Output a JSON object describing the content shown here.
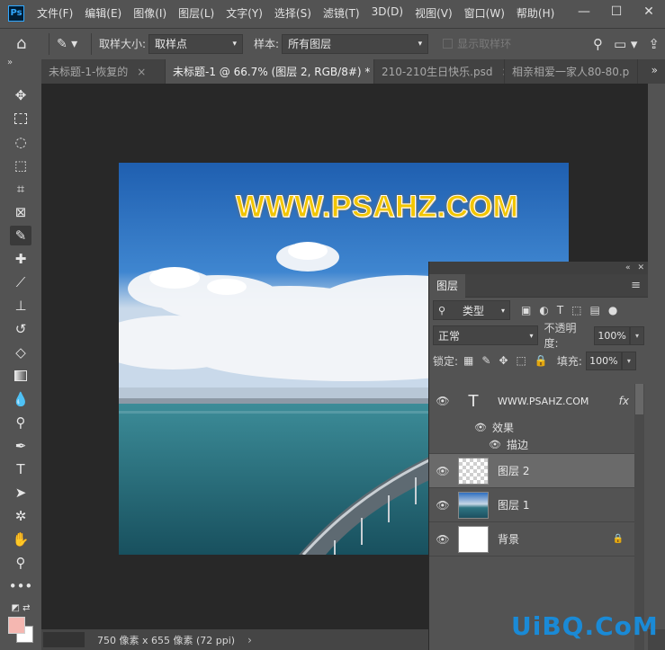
{
  "app": {
    "logo": "Ps"
  },
  "menu": [
    "文件(F)",
    "编辑(E)",
    "图像(I)",
    "图层(L)",
    "文字(Y)",
    "选择(S)",
    "滤镜(T)",
    "3D(D)",
    "视图(V)",
    "窗口(W)",
    "帮助(H)"
  ],
  "window_controls": {
    "minimize": "—",
    "maximize": "☐",
    "close": "✕"
  },
  "options": {
    "sample_size_label": "取样大小:",
    "sample_size_value": "取样点",
    "sample_label": "样本:",
    "sample_value": "所有图层",
    "show_ring_label": "显示取样环"
  },
  "tabs": [
    {
      "label": "未标题-1-恢复的",
      "close": "×"
    },
    {
      "label": "未标题-1 @ 66.7% (图层 2, RGB/8#) *",
      "close": "×"
    },
    {
      "label": "210-210生日快乐.psd",
      "close": "×"
    },
    {
      "label": "相亲相爱一家人80-80.p",
      "close": ""
    }
  ],
  "tabs_overflow": "»",
  "toolbar_collapse": "»",
  "canvas": {
    "headline": "WWW.PSAHZ.COM"
  },
  "status": {
    "info": "750 像素 x 655 像素 (72 ppi)",
    "arrow": "›"
  },
  "layers_panel": {
    "title": "图层",
    "filter_type": "类型",
    "blend_mode": "正常",
    "opacity_label": "不透明度:",
    "opacity_value": "100%",
    "lock_label": "锁定:",
    "fill_label": "填充:",
    "fill_value": "100%",
    "layers": [
      {
        "name": "WWW.PSAHZ.COM",
        "kind": "text",
        "fx": "fx"
      },
      {
        "name": "图层 2",
        "kind": "transparent",
        "selected": true
      },
      {
        "name": "图层 1",
        "kind": "image"
      },
      {
        "name": "背景",
        "kind": "white",
        "locked": true
      }
    ],
    "effects_label": "效果",
    "stroke_label": "描边"
  },
  "watermark": {
    "part1": "UiBQ",
    "part2": ".CoM"
  }
}
